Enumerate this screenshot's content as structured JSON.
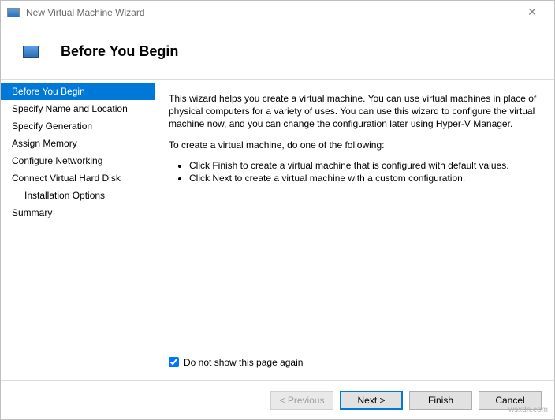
{
  "window": {
    "title": "New Virtual Machine Wizard",
    "close_glyph": "✕"
  },
  "header": {
    "title": "Before You Begin"
  },
  "sidebar": {
    "steps": [
      {
        "label": "Before You Begin",
        "active": true,
        "sub": false
      },
      {
        "label": "Specify Name and Location",
        "active": false,
        "sub": false
      },
      {
        "label": "Specify Generation",
        "active": false,
        "sub": false
      },
      {
        "label": "Assign Memory",
        "active": false,
        "sub": false
      },
      {
        "label": "Configure Networking",
        "active": false,
        "sub": false
      },
      {
        "label": "Connect Virtual Hard Disk",
        "active": false,
        "sub": false
      },
      {
        "label": "Installation Options",
        "active": false,
        "sub": true
      },
      {
        "label": "Summary",
        "active": false,
        "sub": false
      }
    ]
  },
  "content": {
    "intro": "This wizard helps you create a virtual machine. You can use virtual machines in place of physical computers for a variety of uses. You can use this wizard to configure the virtual machine now, and you can change the configuration later using Hyper-V Manager.",
    "instruction": "To create a virtual machine, do one of the following:",
    "bullets": [
      "Click Finish to create a virtual machine that is configured with default values.",
      "Click Next to create a virtual machine with a custom configuration."
    ],
    "checkbox_label": "Do not show this page again",
    "checkbox_checked": true
  },
  "footer": {
    "previous": "< Previous",
    "next": "Next >",
    "finish": "Finish",
    "cancel": "Cancel"
  },
  "watermark": "wsxdn.com"
}
